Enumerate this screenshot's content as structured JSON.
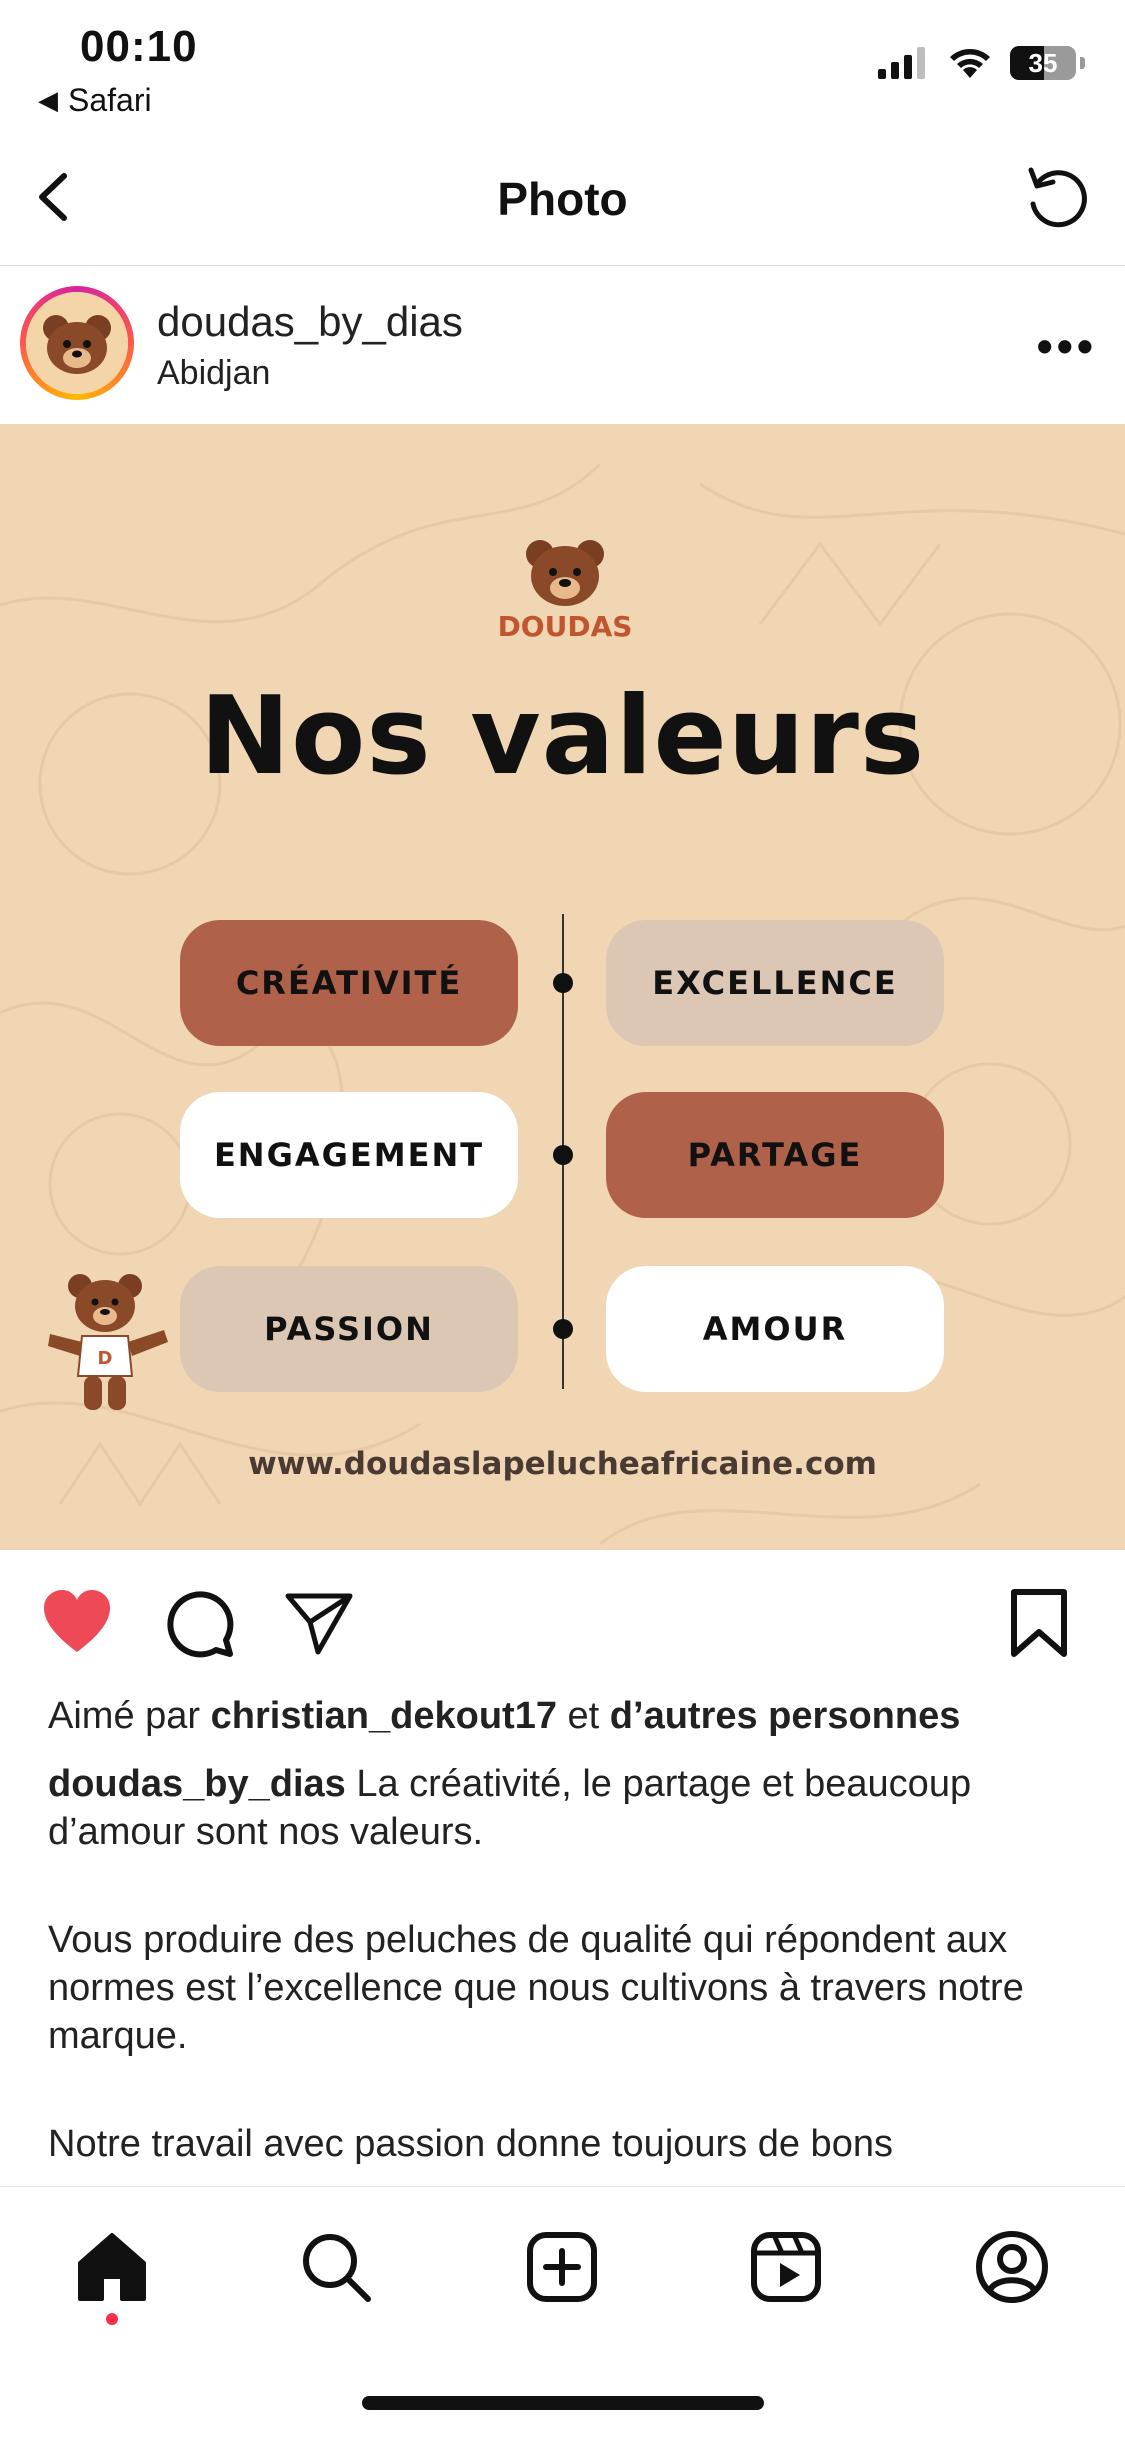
{
  "status_bar": {
    "time": "00:10",
    "back_app": "Safari",
    "battery": "35"
  },
  "nav": {
    "title": "Photo"
  },
  "post": {
    "username": "doudas_by_dias",
    "location": "Abidjan",
    "image": {
      "logo_text": "DOUDAS",
      "headline": "Nos valeurs",
      "values_left": [
        "CRÉATIVITÉ",
        "ENGAGEMENT",
        "PASSION"
      ],
      "values_right": [
        "EXCELLENCE",
        "PARTAGE",
        "AMOUR"
      ],
      "website": "www.doudaslapelucheafricaine.com"
    },
    "likes": {
      "prefix": "Aimé par",
      "user": "christian_dekout17",
      "and": "et",
      "others": "d’autres personnes"
    },
    "caption": {
      "username": "doudas_by_dias",
      "line1": "La créativité, le partage et beaucoup d’amour sont nos valeurs.",
      "para2": "Vous produire des peluches de qualité qui répondent aux normes est l’excellence que nous cultivons à travers notre marque.",
      "para3": "Notre travail avec passion donne toujours de bons"
    },
    "liked": true
  },
  "colors": {
    "heart": "#ed4956",
    "brown": "#b06149",
    "beige_bg": "#f0d6b3"
  },
  "tabbar": {
    "items": [
      "home-icon",
      "search-icon",
      "create-icon",
      "reels-icon",
      "profile-icon"
    ],
    "active": "home-icon"
  }
}
